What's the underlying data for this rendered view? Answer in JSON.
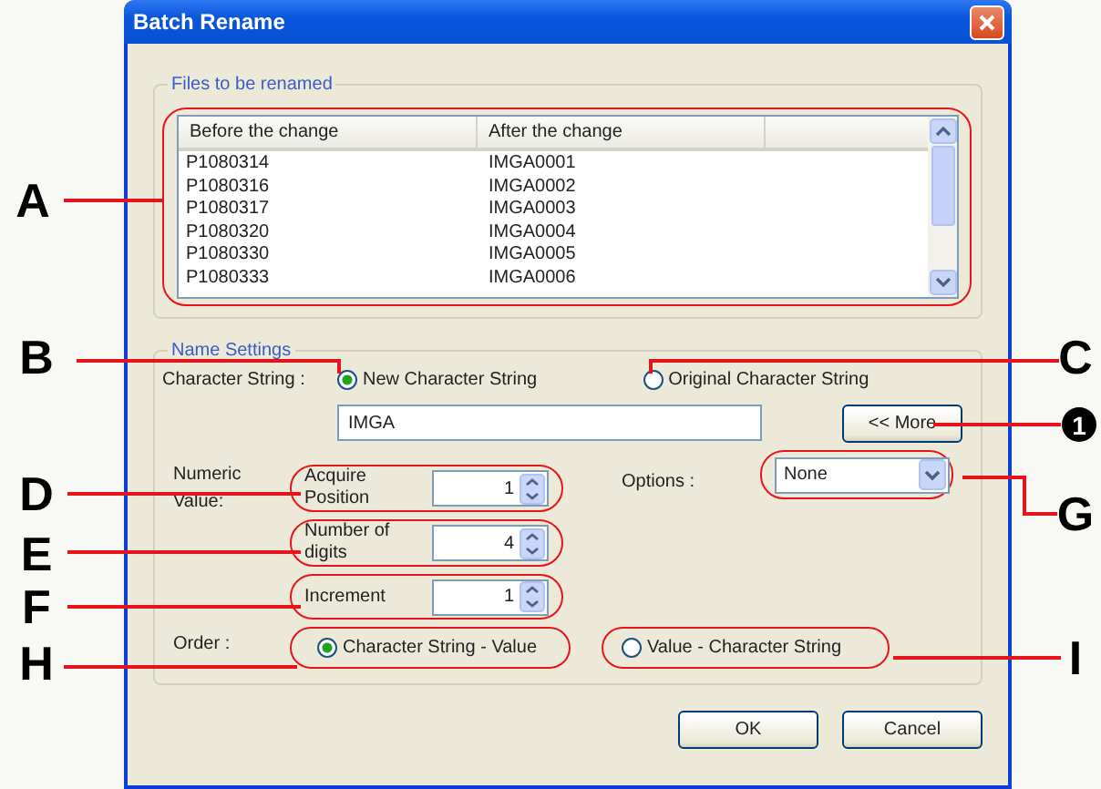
{
  "window": {
    "title": "Batch Rename"
  },
  "files_group": {
    "title": "Files to be renamed",
    "columns": [
      "Before the change",
      "After the change"
    ],
    "rows": [
      [
        "P1080314",
        "IMGA0001"
      ],
      [
        "P1080316",
        "IMGA0002"
      ],
      [
        "P1080317",
        "IMGA0003"
      ],
      [
        "P1080320",
        "IMGA0004"
      ],
      [
        "P1080330",
        "IMGA0005"
      ],
      [
        "P1080333",
        "IMGA0006"
      ]
    ]
  },
  "name_settings": {
    "title": "Name Settings",
    "character_string_label": "Character String :",
    "string_options": [
      {
        "label": "New Character String",
        "selected": true
      },
      {
        "label": "Original Character String",
        "selected": false
      }
    ],
    "string_value": "IMGA",
    "more_button": "<< More",
    "numeric_label": "Numeric Value:",
    "numeric_fields": [
      {
        "label": "Acquire Position",
        "value": "1"
      },
      {
        "label": "Number of digits",
        "value": "4"
      },
      {
        "label": "Increment",
        "value": "1"
      }
    ],
    "options_label": "Options :",
    "options_value": "None",
    "order_label": "Order :",
    "order_options": [
      {
        "label": "Character String - Value",
        "selected": true
      },
      {
        "label": "Value - Character String",
        "selected": false
      }
    ]
  },
  "buttons": [
    "OK",
    "Cancel"
  ],
  "callouts": [
    {
      "label": "A"
    },
    {
      "label": "B"
    },
    {
      "label": "C"
    },
    {
      "label": "1"
    },
    {
      "label": "D"
    },
    {
      "label": "G"
    },
    {
      "label": "E"
    },
    {
      "label": "F"
    },
    {
      "label": "H"
    },
    {
      "label": "I"
    }
  ]
}
